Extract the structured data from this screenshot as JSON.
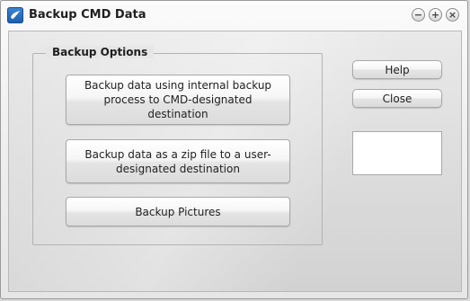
{
  "window": {
    "title": "Backup CMD Data"
  },
  "title_buttons": {
    "minimize": "−",
    "maximize": "+",
    "close": "×"
  },
  "group": {
    "title": "Backup Options"
  },
  "actions": {
    "internal": "Backup data using internal backup process to CMD-designated destination",
    "zip": "Backup data as a zip file to a user-designated destination",
    "pictures": "Backup Pictures"
  },
  "side": {
    "help": "Help",
    "close": "Close",
    "info_text": ""
  },
  "colors": {
    "accent": "#2a6fc4",
    "window_bg": "#f0f0f0"
  },
  "icons": {
    "app": "backup-app-icon"
  }
}
